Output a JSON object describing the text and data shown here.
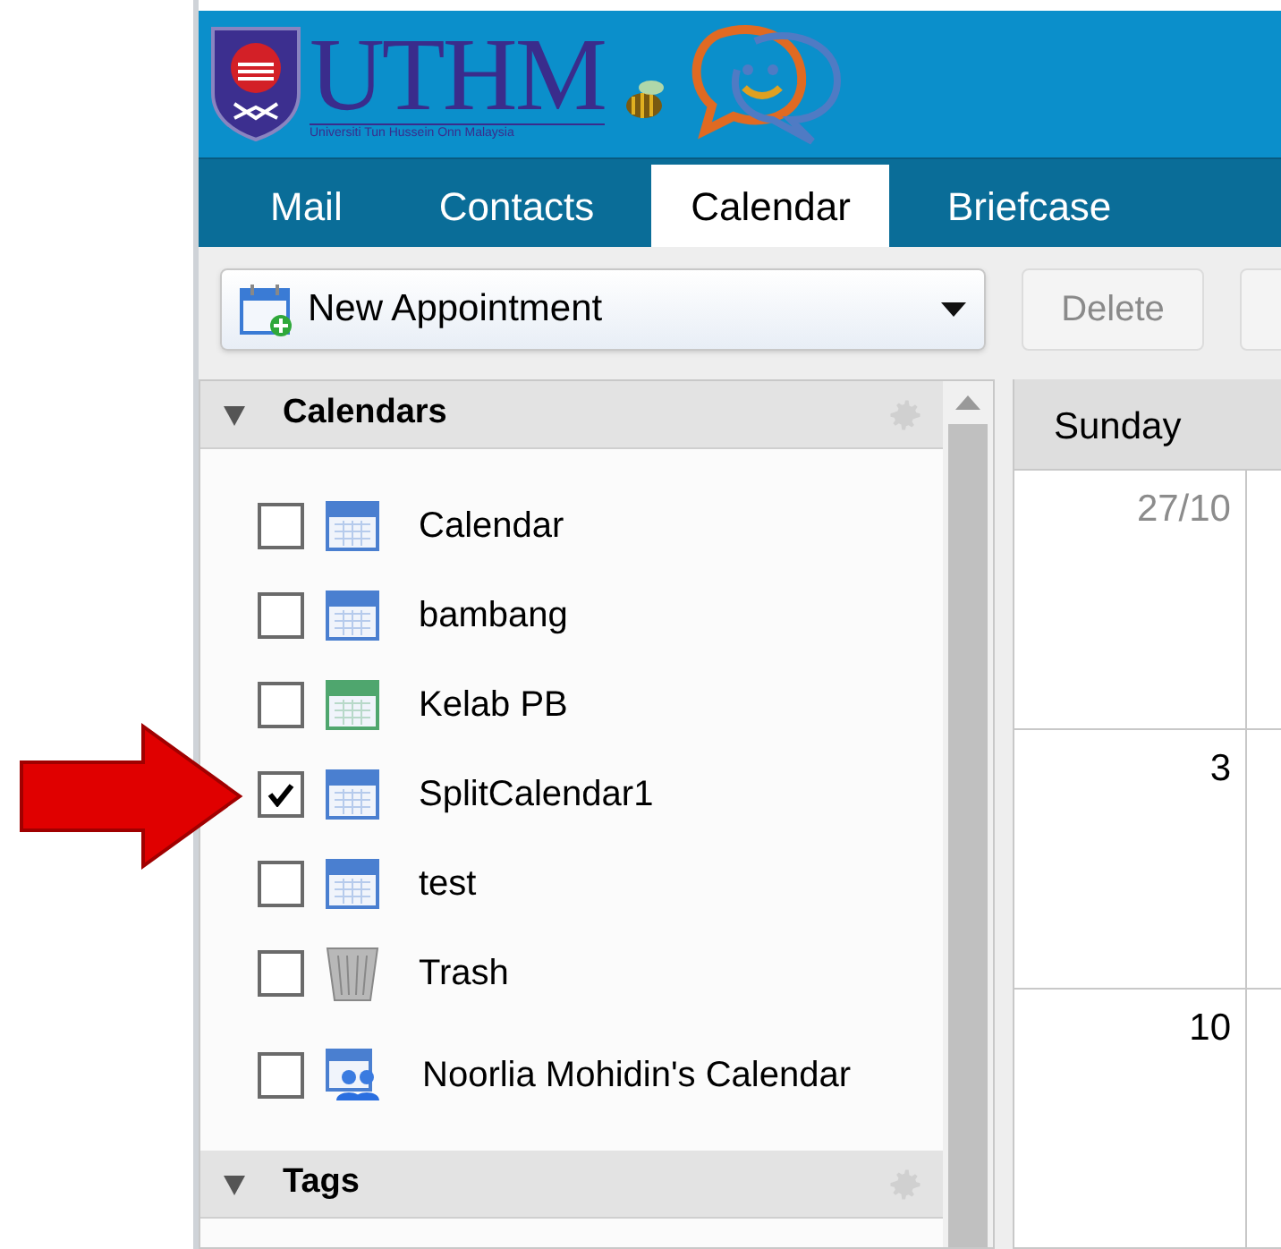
{
  "header": {
    "logo_text": "UTHM",
    "logo_subtext": "Universiti Tun Hussein Onn Malaysia"
  },
  "tabs": [
    {
      "label": "Mail",
      "selected": false
    },
    {
      "label": "Contacts",
      "selected": false
    },
    {
      "label": "Calendar",
      "selected": true
    },
    {
      "label": "Briefcase",
      "selected": false
    }
  ],
  "toolbar": {
    "new_button": "New Appointment",
    "delete_button": "Delete",
    "delete_disabled": true
  },
  "calendars": {
    "title": "Calendars",
    "expanded": true,
    "items": [
      {
        "label": "Calendar",
        "kind": "calendar",
        "color": "#4a7fd0",
        "checked": false
      },
      {
        "label": "bambang",
        "kind": "calendar",
        "color": "#4a7fd0",
        "checked": false
      },
      {
        "label": "Kelab PB",
        "kind": "calendar",
        "color": "#4fa66e",
        "checked": false
      },
      {
        "label": "SplitCalendar1",
        "kind": "calendar",
        "color": "#4a7fd0",
        "checked": true
      },
      {
        "label": "test",
        "kind": "calendar",
        "color": "#4a7fd0",
        "checked": false
      },
      {
        "label": "Trash",
        "kind": "trash",
        "checked": false
      },
      {
        "label": "Noorlia Mohidin's Calendar",
        "kind": "shared",
        "checked": false
      }
    ]
  },
  "tags": {
    "title": "Tags",
    "expanded": true
  },
  "month_view": {
    "day_header": "Sunday",
    "cells": [
      {
        "date": "27/10",
        "other_month": true
      },
      {
        "date": "3",
        "other_month": false
      },
      {
        "date": "10",
        "other_month": false
      }
    ]
  },
  "annotation": {
    "kind": "arrow"
  }
}
